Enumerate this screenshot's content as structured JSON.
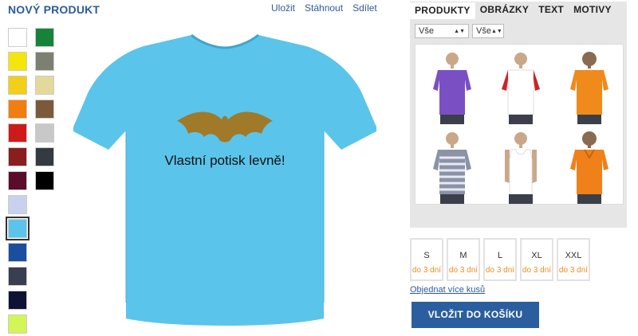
{
  "header": {
    "title": "NOVÝ PRODUKT",
    "links": [
      "Uložit",
      "Stáhnout",
      "Sdílet"
    ]
  },
  "colors": {
    "swatches": [
      "#ffffff",
      "#16833a",
      "#f4e60c",
      "#7c8070",
      "#f2cf1a",
      "#e2d99a",
      "#f07e10",
      "#7a5a3a",
      "#cf1a1a",
      "#c8c8c8",
      "#8a1d1d",
      "#343a40",
      "#5a0c2a",
      "#000000",
      "#c7d3ec",
      "#5bc4ea",
      "#1a4fa0",
      "#3a3e52",
      "#0e1233",
      "#d3f556"
    ],
    "selected": "#5bc4ea",
    "shirt": "#5bc4ea",
    "accent": "#2d5a9e",
    "availability": "#f28a1e"
  },
  "design": {
    "print_text": "Vlastní potisk levně!",
    "graphic": "bat-icon"
  },
  "tabs": [
    "PRODUKTY",
    "OBRÁZKY",
    "TEXT",
    "MOTIVY"
  ],
  "filters": [
    "Vše",
    "Vše"
  ],
  "products": [
    {
      "name": "purple-tshirt",
      "color": "#7b4fc4"
    },
    {
      "name": "white-red-raglan",
      "color": "#ffffff",
      "sleeve": "#d0212a"
    },
    {
      "name": "orange-tshirt",
      "color": "#f08a1a"
    },
    {
      "name": "striped-tshirt",
      "color": "#8b93a8"
    },
    {
      "name": "white-tank-top",
      "color": "#ffffff"
    },
    {
      "name": "orange-polo",
      "color": "#f0801a"
    }
  ],
  "sizes": [
    {
      "label": "S",
      "availability": "do 3 dní"
    },
    {
      "label": "M",
      "availability": "do 3 dní"
    },
    {
      "label": "L",
      "availability": "do 3 dní"
    },
    {
      "label": "XL",
      "availability": "do 3 dní"
    },
    {
      "label": "XXL",
      "availability": "do 3 dní"
    }
  ],
  "order_more": "Objednat více kusů",
  "cart_button": "VLOŽIT DO KOŠÍKU"
}
